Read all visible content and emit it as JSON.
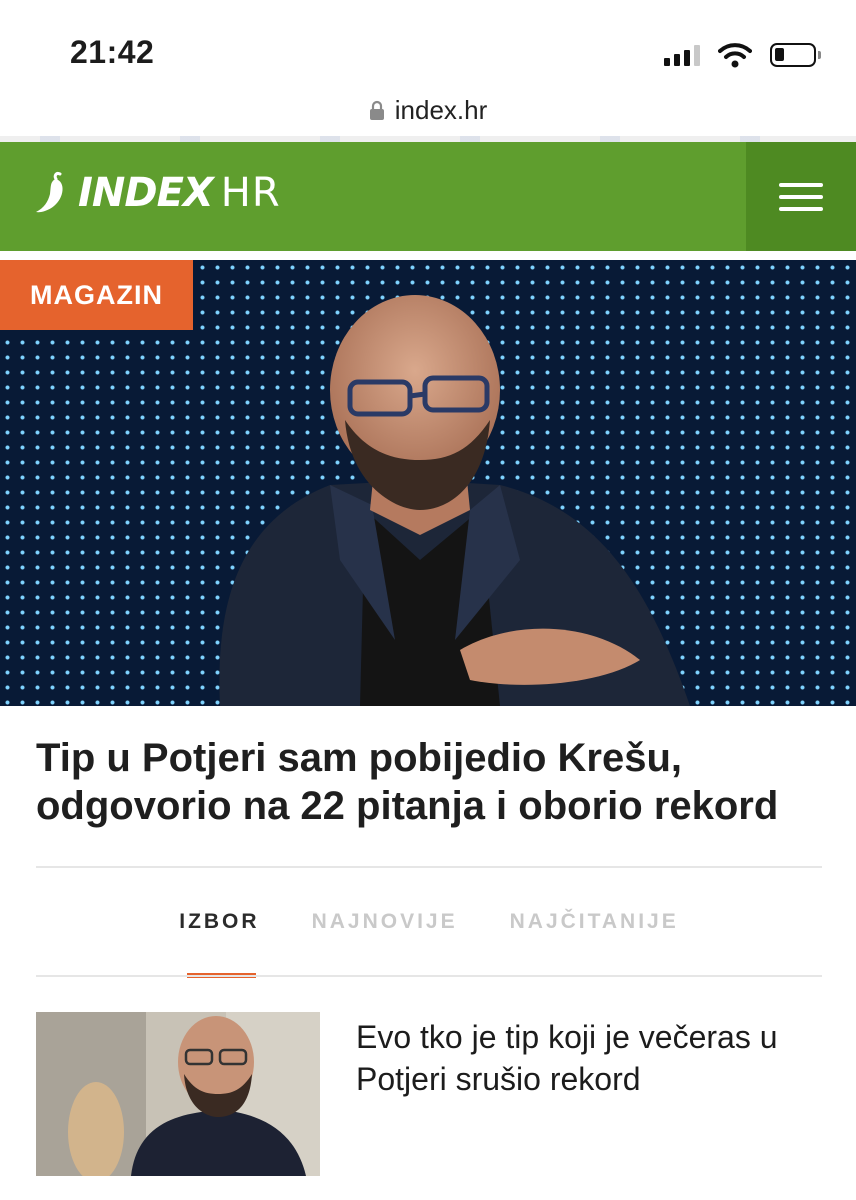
{
  "status_bar": {
    "time": "21:42",
    "signal_bars": 3,
    "signal_bars_total": 4,
    "battery_level": 0.25,
    "icons": [
      "signal-icon",
      "wifi-icon",
      "battery-icon"
    ]
  },
  "browser": {
    "url": "index.hr",
    "lock_icon": "lock-icon"
  },
  "header": {
    "logo_main": "INDEX",
    "logo_suffix": "HR",
    "menu_icon": "hamburger-menu-icon",
    "color": "#5f9e2e"
  },
  "featured": {
    "category": "MAGAZIN",
    "category_color": "#e5632d",
    "headline": "Tip u Potjeri sam pobijedio Krešu, odgovorio na 22 pitanja i oborio rekord"
  },
  "tabs": [
    {
      "label": "IZBOR",
      "active": true
    },
    {
      "label": "NAJNOVIJE",
      "active": false
    },
    {
      "label": "NAJČITANIJE",
      "active": false
    }
  ],
  "articles": [
    {
      "title": "Evo tko je tip koji je večeras u Potjeri srušio rekord"
    }
  ]
}
